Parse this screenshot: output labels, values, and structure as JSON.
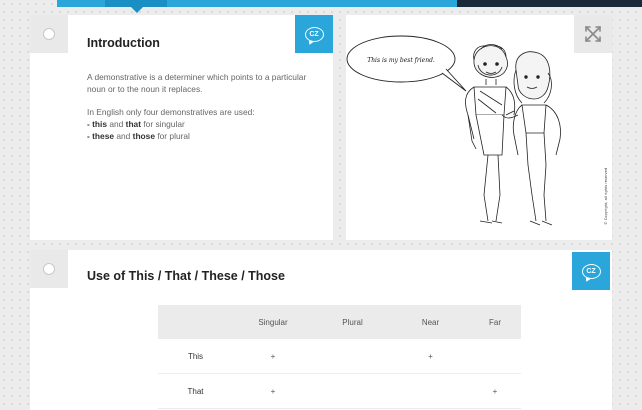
{
  "intro": {
    "title": "Introduction",
    "para1": "A demonstrative is a determiner which points to a particular noun or to the noun it replaces.",
    "para2_intro": "In English only four demonstratives are used:",
    "line1_bullet": "- ",
    "line1_word1": "this",
    "line1_and": " and ",
    "line1_word2": "that",
    "line1_rest": " for singular",
    "line2_bullet": "- ",
    "line2_word1": "these",
    "line2_and": " and ",
    "line2_word2": "those",
    "line2_rest": " for plural",
    "lang_badge": "CZ"
  },
  "illustration": {
    "speech": "This is my best friend.",
    "copyright": "© Copyright, all rights reserved"
  },
  "usage": {
    "title": "Use of This / That / These / Those",
    "lang_badge": "CZ",
    "table": {
      "headers": [
        "",
        "Singular",
        "Plural",
        "Near",
        "Far"
      ],
      "rows": [
        {
          "label": "This",
          "cells": [
            "+",
            "",
            "+",
            ""
          ]
        },
        {
          "label": "That",
          "cells": [
            "+",
            "",
            "",
            "+"
          ]
        }
      ]
    }
  },
  "colors": {
    "accent": "#2aa6db",
    "accent_dark": "#1a8fc4",
    "topbar_dark": "#1b2a38"
  }
}
